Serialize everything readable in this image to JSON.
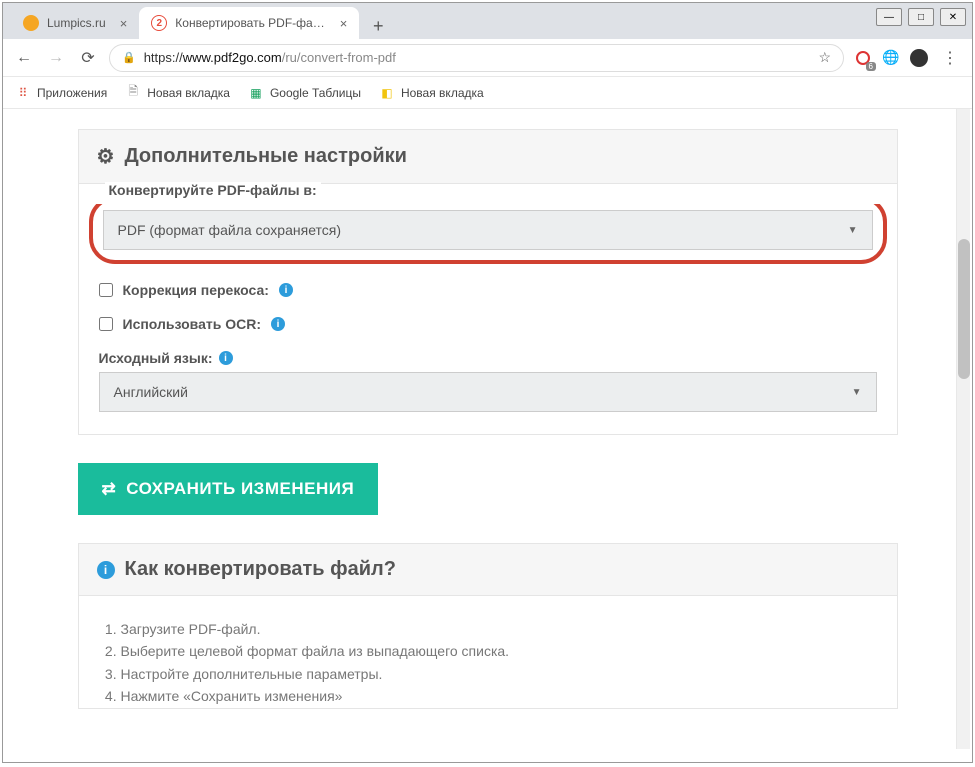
{
  "window": {
    "minimize": "—",
    "maximize": "□",
    "close": "✕"
  },
  "tabs": [
    {
      "title": "Lumpics.ru",
      "favicon_color": "#f5a623",
      "active": false
    },
    {
      "title": "Конвертировать PDF-файл — К",
      "favicon_color": "#e74c3c",
      "active": true
    }
  ],
  "address": {
    "url_https": "https://",
    "url_host": "www.pdf2go.com",
    "url_path": "/ru/convert-from-pdf",
    "badge_count": "6"
  },
  "bookmarks": [
    {
      "icon": "⠿",
      "icon_color": "#d54",
      "label": "Приложения"
    },
    {
      "icon": "🗎",
      "icon_color": "#888",
      "label": "Новая вкладка"
    },
    {
      "icon": "▦",
      "icon_color": "#0f9d58",
      "label": "Google Таблицы"
    },
    {
      "icon": "◧",
      "icon_color": "#f1c40f",
      "label": "Новая вкладка"
    }
  ],
  "page": {
    "settings_title": "Дополнительные настройки",
    "convert_label": "Конвертируйте PDF-файлы в:",
    "format_select_value": "PDF (формат файла сохраняется)",
    "deskew_label": "Коррекция перекоса:",
    "ocr_label": "Использовать OCR:",
    "lang_label": "Исходный язык:",
    "lang_select_value": "Английский",
    "save_btn": "СОХРАНИТЬ ИЗМЕНЕНИЯ",
    "how_title": "Как конвертировать файл?",
    "how_steps": [
      "Загрузите PDF-файл.",
      "Выберите целевой формат файла из выпадающего списка.",
      "Настройте дополнительные параметры.",
      "Нажмите «Сохранить изменения»"
    ]
  }
}
